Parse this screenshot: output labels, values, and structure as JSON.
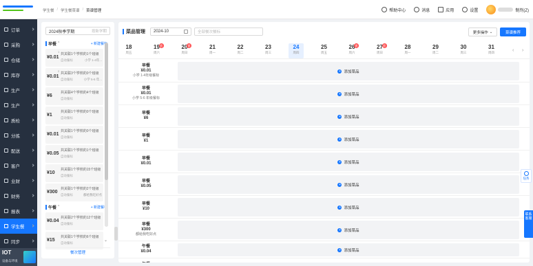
{
  "header": {
    "breadcrumb": [
      "学生餐",
      "学生餐菜谱",
      "菜谱管理"
    ],
    "help_label": "帮助中心",
    "messages_label": "消息",
    "apps_label": "应用",
    "settings_label": "设置",
    "user_role": "制剂(Z)"
  },
  "sidebar": {
    "items": [
      {
        "label": "订单",
        "active": false
      },
      {
        "label": "采购",
        "active": false
      },
      {
        "label": "仓储",
        "active": false
      },
      {
        "label": "库存",
        "active": false
      },
      {
        "label": "生产",
        "active": false
      },
      {
        "label": "生产",
        "active": false
      },
      {
        "label": "质检",
        "active": false
      },
      {
        "label": "分拣",
        "active": false
      },
      {
        "label": "配送",
        "active": false
      },
      {
        "label": "客户",
        "active": false
      },
      {
        "label": "业财",
        "active": false
      },
      {
        "label": "财务",
        "active": false
      },
      {
        "label": "报表",
        "active": false
      },
      {
        "label": "学生餐",
        "active": true
      },
      {
        "label": "同步",
        "active": false
      }
    ],
    "iot": {
      "title": "IOT",
      "subtitle": "设备与环境"
    }
  },
  "left_panel": {
    "term_value": "2024秋季学期",
    "term_placeholder": "按新学期",
    "groups": [
      {
        "name": "早餐",
        "add_label": "+ 新建餐标"
      },
      {
        "name": "午餐",
        "add_label": "+ 新建餐标"
      }
    ],
    "plans": [
      {
        "price": "¥0.01",
        "idx": "1",
        "desc": "共关联1个学校的1个班级",
        "sub": "自动餐标",
        "tag": "小学 1-4年..."
      },
      {
        "price": "¥0.01",
        "idx": "2",
        "desc": "共关联3个学校的0个班级",
        "sub": "自动餐标",
        "tag": "小学 5-6 年..."
      },
      {
        "price": "¥6",
        "idx": "",
        "desc": "共关联4个学校的4个班级",
        "sub": "自动餐标",
        "tag": ""
      },
      {
        "price": "¥1",
        "idx": "",
        "desc": "共关联1个学校的0个班级",
        "sub": "自动餐标",
        "tag": ""
      },
      {
        "price": "¥0.01",
        "idx": "",
        "desc": "共关联1个学校的0个班级",
        "sub": "自动餐标",
        "tag": ""
      },
      {
        "price": "¥0.05",
        "idx": "",
        "desc": "共关联1个学校的1个班级",
        "sub": "自动餐标",
        "tag": ""
      },
      {
        "price": "¥10",
        "idx": "",
        "desc": "共关联1个学校的15个班级",
        "sub": "自动餐标",
        "tag": ""
      },
      {
        "price": "¥300",
        "idx": "",
        "desc": "共关联1个学校的2个班级",
        "sub": "自动餐标",
        "tag": "都给我吃好点"
      },
      {
        "price": "¥0.04",
        "idx": "",
        "desc": "共关联2个学校的12个班级",
        "sub": "自动餐标",
        "tag": ""
      },
      {
        "price": "¥15",
        "idx": "",
        "desc": "共关联1个学校的6个班级",
        "sub": "自动餐标",
        "tag": ""
      }
    ],
    "footer_label": "餐次管理"
  },
  "main": {
    "title": "菜品管理",
    "month_value": "2024-10",
    "search_placeholder": "全部餐次餐标",
    "more_label": "更多操作",
    "recommend_label": "菜谱推荐",
    "days": [
      {
        "day": "18",
        "weekday": "周五",
        "badge": "",
        "selected": false
      },
      {
        "day": "19",
        "weekday": "周六",
        "badge": "班",
        "selected": false
      },
      {
        "day": "20",
        "weekday": "周日",
        "badge": "班",
        "selected": false
      },
      {
        "day": "21",
        "weekday": "周一",
        "badge": "",
        "selected": false
      },
      {
        "day": "22",
        "weekday": "周二",
        "badge": "",
        "selected": false
      },
      {
        "day": "23",
        "weekday": "周三",
        "badge": "",
        "selected": false
      },
      {
        "day": "24",
        "weekday": "周四",
        "badge": "",
        "selected": true
      },
      {
        "day": "25",
        "weekday": "周五",
        "badge": "",
        "selected": false
      },
      {
        "day": "26",
        "weekday": "周六",
        "badge": "班",
        "selected": false
      },
      {
        "day": "27",
        "weekday": "周日",
        "badge": "班",
        "selected": false
      },
      {
        "day": "28",
        "weekday": "周一",
        "badge": "",
        "selected": false
      },
      {
        "day": "29",
        "weekday": "周二",
        "badge": "",
        "selected": false
      },
      {
        "day": "30",
        "weekday": "周三",
        "badge": "",
        "selected": false
      },
      {
        "day": "31",
        "weekday": "周四",
        "badge": "",
        "selected": false
      }
    ],
    "rows": [
      {
        "meal": "早餐",
        "price": "¥0.01",
        "desc": "小学 1-4年级餐标",
        "action": "添加菜品"
      },
      {
        "meal": "早餐",
        "price": "¥0.01",
        "desc": "小学 5-6 年级餐标",
        "action": "添加菜品"
      },
      {
        "meal": "早餐",
        "price": "¥6",
        "desc": "",
        "action": "添加菜品"
      },
      {
        "meal": "早餐",
        "price": "¥1",
        "desc": "",
        "action": "添加菜品"
      },
      {
        "meal": "早餐",
        "price": "¥0.01",
        "desc": "",
        "action": "添加菜品"
      },
      {
        "meal": "早餐",
        "price": "¥0.05",
        "desc": "",
        "action": "添加菜品"
      },
      {
        "meal": "早餐",
        "price": "¥10",
        "desc": "",
        "action": "添加菜品"
      },
      {
        "meal": "早餐",
        "price": "¥300",
        "desc": "都给我吃好点",
        "action": "添加菜品"
      },
      {
        "meal": "午餐",
        "price": "¥0.04",
        "desc": "",
        "action": "添加菜品"
      },
      {
        "meal": "午餐",
        "price": "",
        "desc": "",
        "action": ""
      }
    ]
  },
  "float": {
    "task_label": "任务",
    "service_label": "联系客服"
  },
  "colors": {
    "primary": "#1677ff",
    "sidebar_bg": "#26303f",
    "badge": "#ff4d4f"
  }
}
